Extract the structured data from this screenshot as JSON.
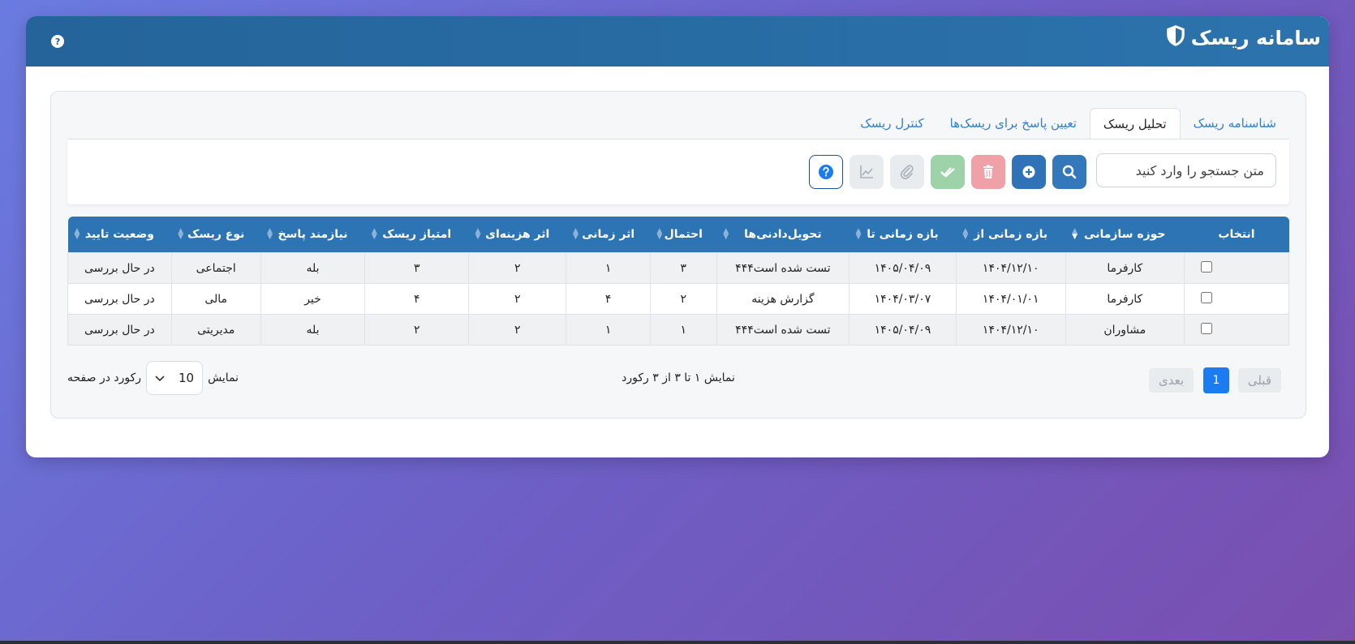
{
  "app": {
    "title": "سامانه ریسک",
    "help_label": "?"
  },
  "tabs": [
    {
      "label": "شناسنامه ریسک",
      "active": false
    },
    {
      "label": "تحلیل ریسک",
      "active": true
    },
    {
      "label": "تعیین پاسخ برای ریسک‌ها",
      "active": false
    },
    {
      "label": "کنترل ریسک",
      "active": false
    }
  ],
  "search": {
    "placeholder": "متن جستجو را وارد کنید",
    "value": ""
  },
  "toolbar": {
    "buttons": [
      {
        "icon": "search-icon",
        "color": "#2f72b8"
      },
      {
        "icon": "plus-circle-icon",
        "color": "#2f72b8"
      },
      {
        "icon": "trash-icon",
        "color": "#f0a1a7"
      },
      {
        "icon": "double-check-icon",
        "color": "#9ed3a9"
      },
      {
        "icon": "paperclip-icon",
        "color": "#e9ecef"
      },
      {
        "icon": "chart-line-icon",
        "color": "#e9ecef"
      },
      {
        "icon": "question-circle-icon",
        "color": "#ffffff"
      }
    ]
  },
  "table": {
    "headers": [
      "انتخاب",
      "حوزه سازمانی",
      "بازه زمانی از",
      "بازه زمانی تا",
      "تحویل‌دادنی‌ها",
      "احتمال",
      "اثر زمانی",
      "اثر هزینه‌ای",
      "امتیاز ریسک",
      "نیازمند پاسخ",
      "نوع ریسک",
      "وضعیت تایید"
    ],
    "rows": [
      [
        "کارفرما",
        "۱۴۰۴/۱۲/۱۰",
        "۱۴۰۵/۰۴/۰۹",
        "تست شده است۴۴۴",
        "۳",
        "۱",
        "۲",
        "۳",
        "بله",
        "اجتماعی",
        "در حال بررسی"
      ],
      [
        "کارفرما",
        "۱۴۰۴/۰۱/۰۱",
        "۱۴۰۴/۰۳/۰۷",
        "گزارش هزینه",
        "۲",
        "۴",
        "۲",
        "۴",
        "خیر",
        "مالی",
        "در حال بررسی"
      ],
      [
        "مشاوران",
        "۱۴۰۴/۱۲/۱۰",
        "۱۴۰۵/۰۴/۰۹",
        "تست شده است۴۴۴",
        "۱",
        "۱",
        "۲",
        "۲",
        "بله",
        "مدیریتی",
        "در حال بررسی"
      ]
    ]
  },
  "pagination": {
    "prev_label": "قبلی",
    "current_page": "1",
    "next_label": "بعدی",
    "info": "نمایش ۱ تا ۳ از ۳ رکورد",
    "per_page_prefix": "نمایش",
    "per_page_value": "10",
    "per_page_suffix": "رکورد در صفحه"
  }
}
